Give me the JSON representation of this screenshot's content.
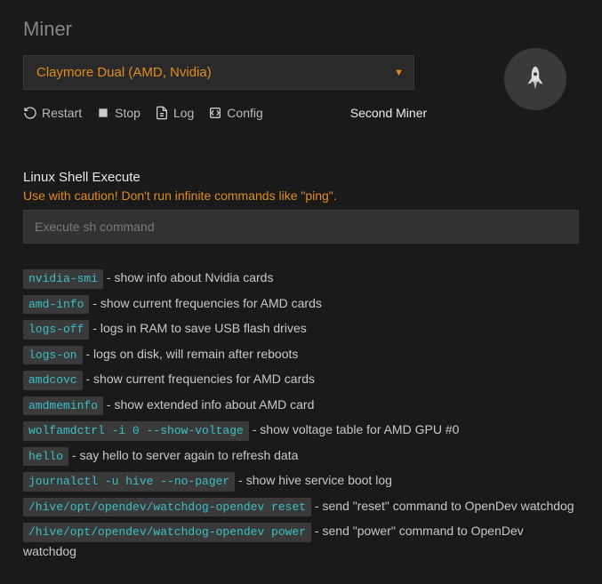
{
  "header": {
    "title": "Miner",
    "selected_miner": "Claymore Dual (AMD, Nvidia)",
    "second_miner_label": "Second Miner"
  },
  "toolbar": {
    "restart_label": "Restart",
    "stop_label": "Stop",
    "log_label": "Log",
    "config_label": "Config"
  },
  "shell": {
    "title": "Linux Shell Execute",
    "warning": "Use with caution! Don't run infinite commands like \"ping\".",
    "placeholder": "Execute sh command"
  },
  "commands": [
    {
      "cmd": "nvidia-smi",
      "desc": "show info about Nvidia cards"
    },
    {
      "cmd": "amd-info",
      "desc": "show current frequencies for AMD cards"
    },
    {
      "cmd": "logs-off",
      "desc": "logs in RAM to save USB flash drives"
    },
    {
      "cmd": "logs-on",
      "desc": "logs on disk, will remain after reboots"
    },
    {
      "cmd": "amdcovc",
      "desc": "show current frequencies for AMD cards"
    },
    {
      "cmd": "amdmeminfo",
      "desc": "show extended info about AMD card"
    },
    {
      "cmd": "wolfamdctrl -i 0 --show-voltage",
      "desc": "show voltage table for AMD GPU #0"
    },
    {
      "cmd": "hello",
      "desc": "say hello to server again to refresh data"
    },
    {
      "cmd": "journalctl -u hive --no-pager",
      "desc": "show hive service boot log"
    },
    {
      "cmd": "/hive/opt/opendev/watchdog-opendev reset",
      "desc": "send \"reset\" command to OpenDev watchdog"
    },
    {
      "cmd": "/hive/opt/opendev/watchdog-opendev power",
      "desc": "send \"power\" command to OpenDev watchdog"
    }
  ]
}
